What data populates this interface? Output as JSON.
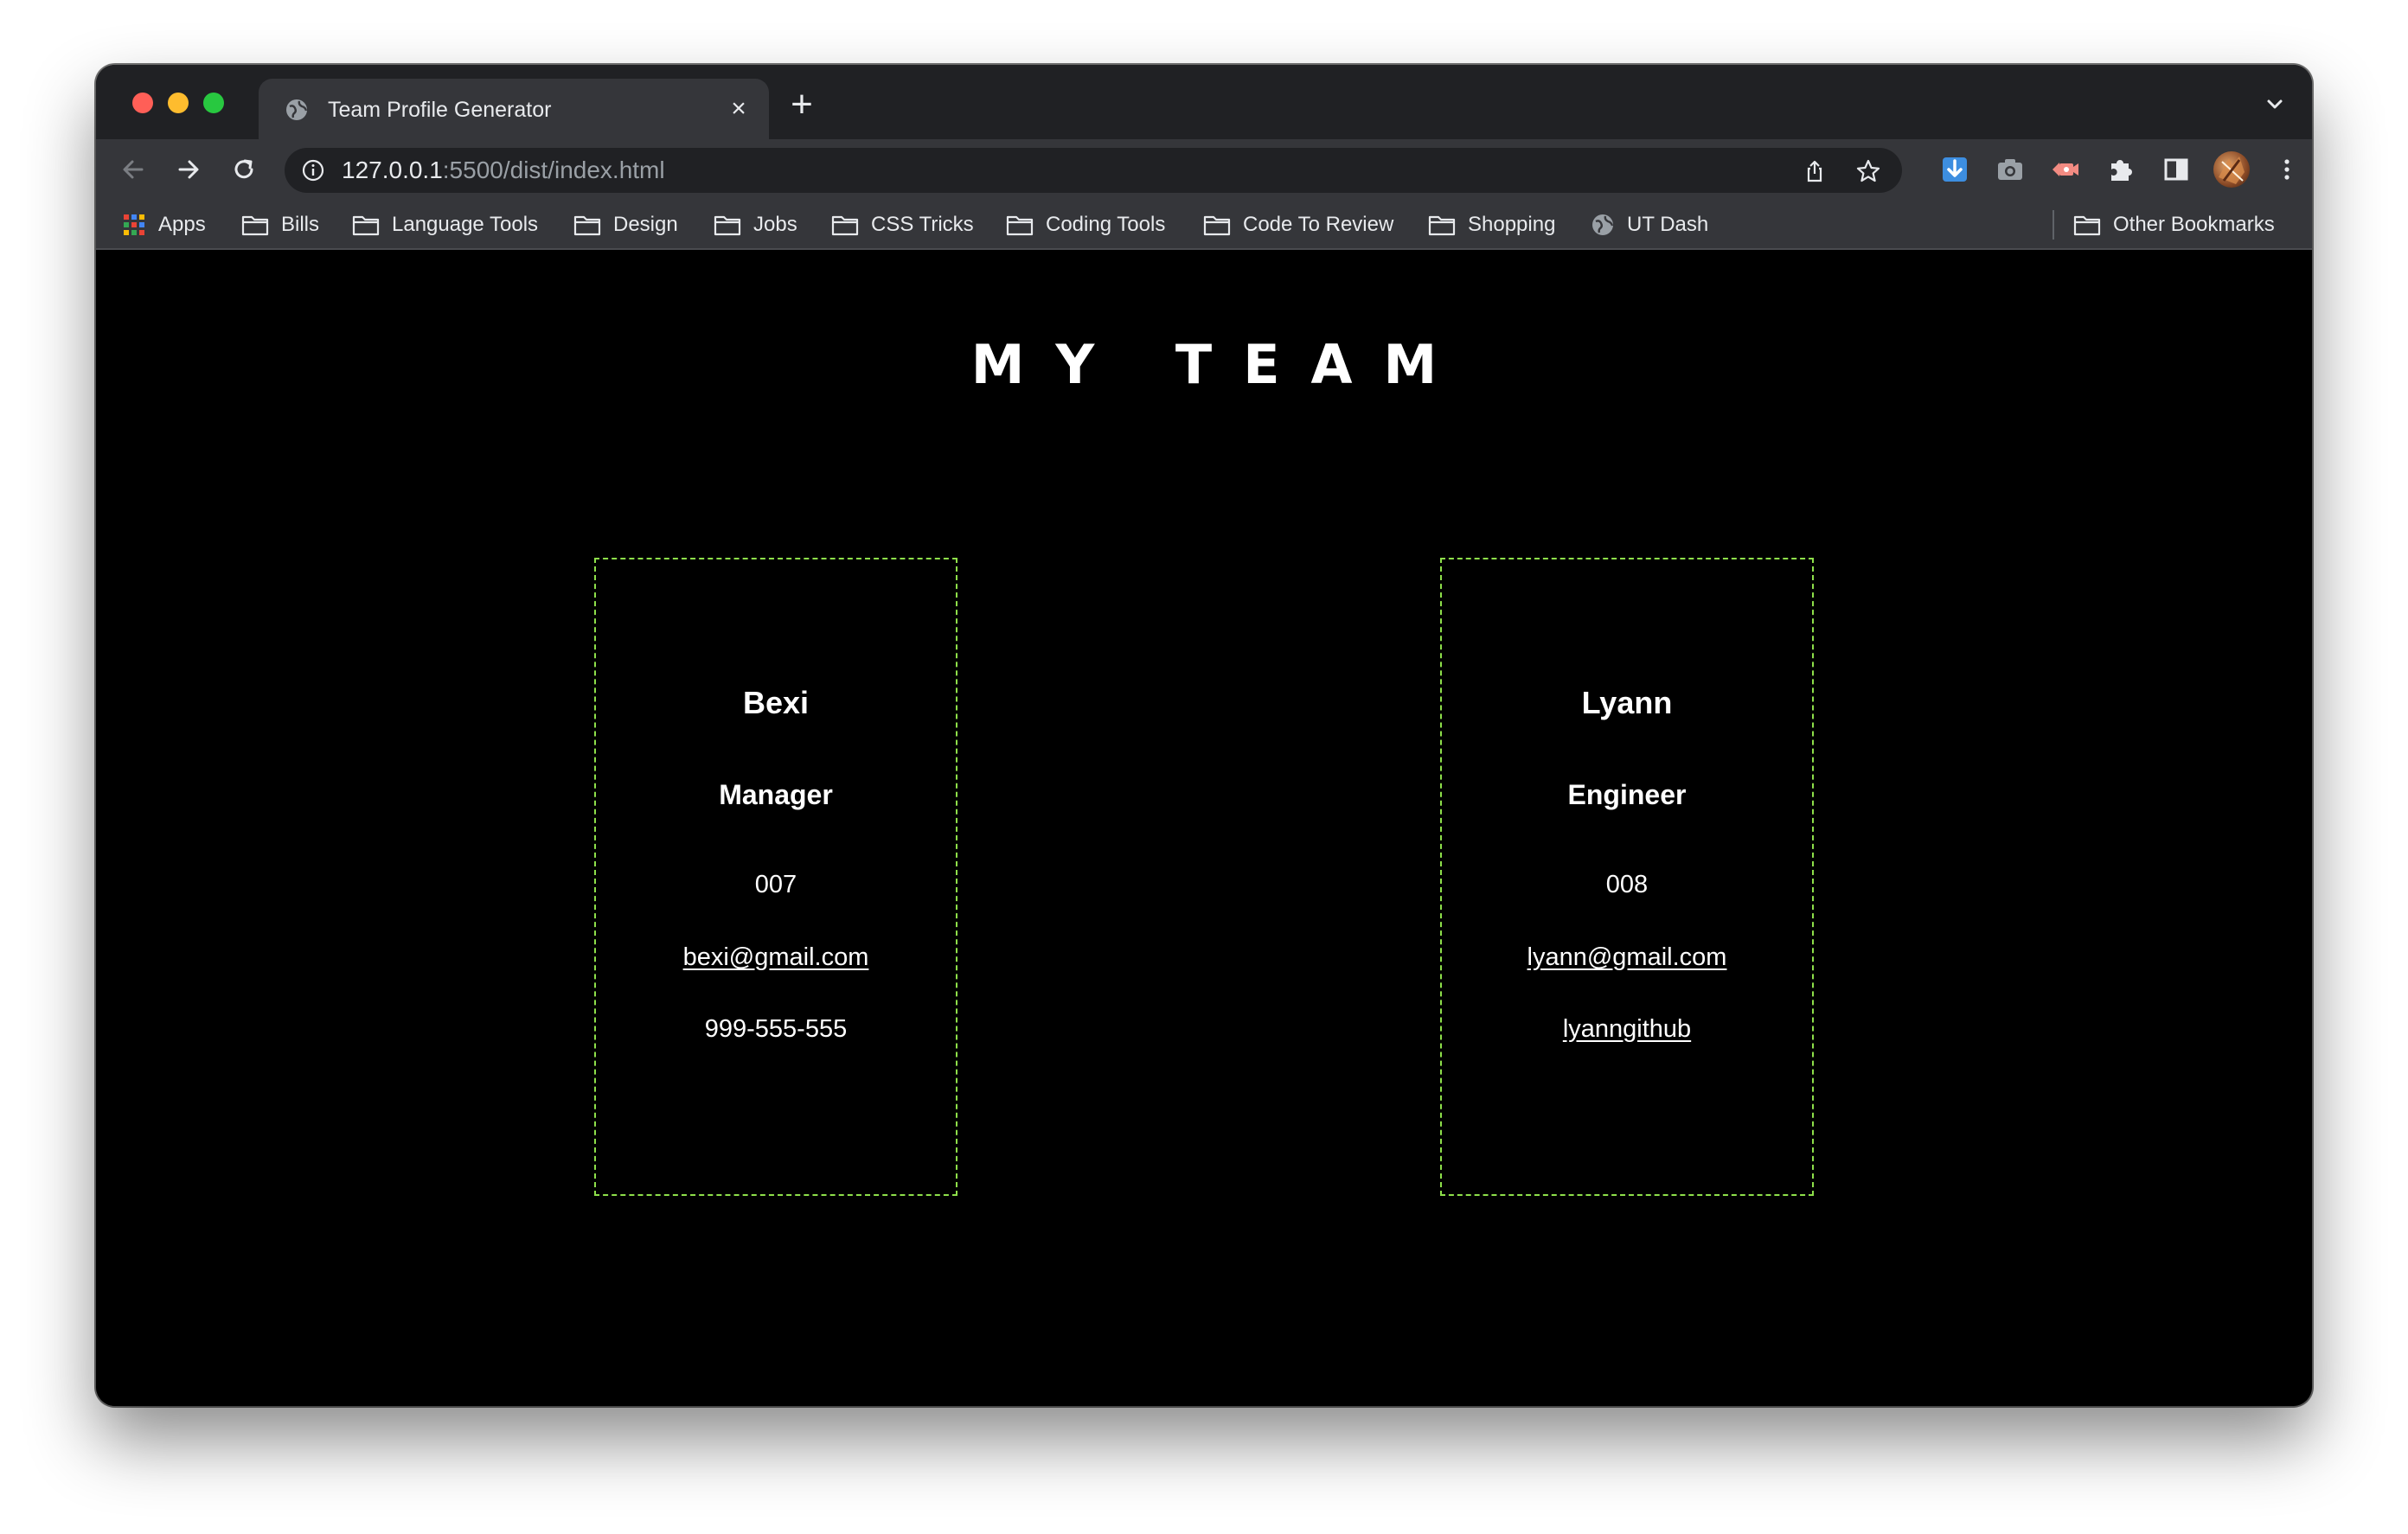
{
  "browser": {
    "tab": {
      "title": "Team Profile Generator",
      "close_glyph": "×",
      "favicon": "globe-icon"
    },
    "new_tab_glyph": "+",
    "url": {
      "host": "127.0.0.1",
      "rest": ":5500/dist/index.html"
    },
    "bookmarks": [
      {
        "label": "Apps",
        "icon": "apps-grid-icon"
      },
      {
        "label": "Bills",
        "icon": "folder-icon"
      },
      {
        "label": "Language Tools",
        "icon": "folder-icon"
      },
      {
        "label": "Design",
        "icon": "folder-icon"
      },
      {
        "label": "Jobs",
        "icon": "folder-icon"
      },
      {
        "label": "CSS Tricks",
        "icon": "folder-icon"
      },
      {
        "label": "Coding Tools",
        "icon": "folder-icon"
      },
      {
        "label": "Code To Review",
        "icon": "folder-icon"
      },
      {
        "label": "Shopping",
        "icon": "folder-icon"
      },
      {
        "label": "UT Dash",
        "icon": "globe-icon"
      }
    ],
    "other_bookmarks": {
      "label": "Other Bookmarks",
      "icon": "folder-icon"
    }
  },
  "page": {
    "title": "MY TEAM",
    "team": [
      {
        "name": "Bexi",
        "role": "Manager",
        "id": "007",
        "email": "bexi@gmail.com",
        "extra": "999-555-555",
        "extra_is_link": false
      },
      {
        "name": "Lyann",
        "role": "Engineer",
        "id": "008",
        "email": "lyann@gmail.com",
        "extra": "lyanngithub",
        "extra_is_link": true
      }
    ]
  },
  "colors": {
    "card_border": "#8ee04a",
    "page_background": "#000000",
    "chrome_dark": "#202124",
    "chrome_mid": "#35363a"
  }
}
